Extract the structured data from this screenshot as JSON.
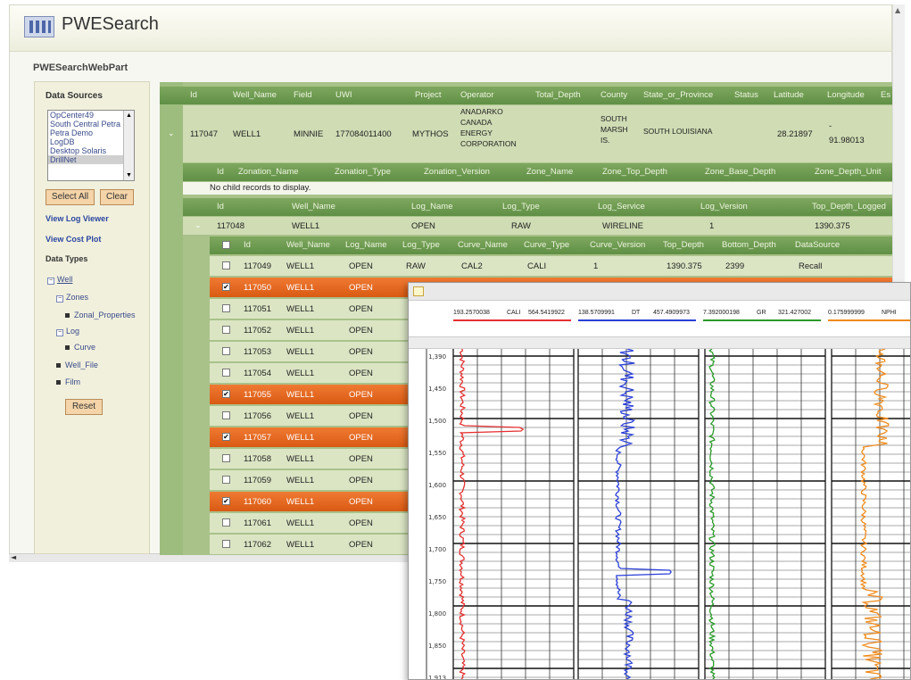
{
  "app": {
    "title": "PWESearch",
    "webpart_title": "PWESearchWebPart"
  },
  "left_panel": {
    "data_sources_title": "Data Sources",
    "data_sources": [
      "OpCenter49",
      "South Central Petra",
      "Petra Demo",
      "LogDB",
      "Desktop Solaris",
      "DrillNet"
    ],
    "select_all": "Select All",
    "clear": "Clear",
    "view_log_viewer": "View Log Viewer",
    "view_cost_plot": "View Cost Plot",
    "data_types_title": "Data Types",
    "tree": {
      "well": "Well",
      "zones": "Zones",
      "zonal_properties": "Zonal_Properties",
      "log": "Log",
      "curve": "Curve",
      "well_file": "Well_File",
      "film": "Film"
    },
    "reset": "Reset"
  },
  "well_grid": {
    "headers": [
      "Id",
      "Well_Name",
      "Field",
      "UWI",
      "Project",
      "Operator",
      "Total_Depth",
      "County",
      "State_or_Province",
      "Status",
      "Latitude",
      "Longitude",
      "Es"
    ],
    "row": {
      "id": "117047",
      "well_name": "WELL1",
      "field": "MINNIE",
      "uwi": "177084011400",
      "project": "MYTHOS",
      "operator": [
        "ANADARKO",
        "CANADA",
        "ENERGY",
        "CORPORATION"
      ],
      "county": [
        "SOUTH",
        "MARSH",
        "IS."
      ],
      "state": "SOUTH LOUISIANA",
      "latitude": "28.21897",
      "longitude_dash": "-",
      "longitude": "91.98013"
    }
  },
  "zonation_grid": {
    "headers": [
      "Id",
      "Zonation_Name",
      "Zonation_Type",
      "Zonation_Version",
      "Zone_Name",
      "Zone_Top_Depth",
      "Zone_Base_Depth",
      "Zone_Depth_Unit"
    ],
    "empty_text": "No child records to display."
  },
  "log_grid": {
    "headers": [
      "Id",
      "Well_Name",
      "Log_Name",
      "Log_Type",
      "Log_Service",
      "Log_Version",
      "Top_Depth_Logged"
    ],
    "row": {
      "id": "117048",
      "well_name": "WELL1",
      "log_name": "OPEN",
      "log_type": "RAW",
      "log_service": "WIRELINE",
      "log_version": "1",
      "top_depth": "1390.375"
    }
  },
  "curve_grid": {
    "headers": [
      "Id",
      "Well_Name",
      "Log_Name",
      "Log_Type",
      "Curve_Name",
      "Curve_Type",
      "Curve_Version",
      "Top_Depth",
      "Bottom_Depth",
      "DataSource"
    ],
    "first_row": {
      "id": "117049",
      "well_name": "WELL1",
      "log_name": "OPEN",
      "log_type": "RAW",
      "curve_name": "CAL2",
      "curve_type": "CALI",
      "curve_version": "1",
      "top_depth": "1390.375",
      "bottom_depth": "2399",
      "datasource": "Recall"
    },
    "rows": [
      {
        "id": "117050",
        "well_name": "WELL1",
        "log_name": "OPEN",
        "checked": true
      },
      {
        "id": "117051",
        "well_name": "WELL1",
        "log_name": "OPEN",
        "checked": false
      },
      {
        "id": "117052",
        "well_name": "WELL1",
        "log_name": "OPEN",
        "checked": false
      },
      {
        "id": "117053",
        "well_name": "WELL1",
        "log_name": "OPEN",
        "checked": false
      },
      {
        "id": "117054",
        "well_name": "WELL1",
        "log_name": "OPEN",
        "checked": false
      },
      {
        "id": "117055",
        "well_name": "WELL1",
        "log_name": "OPEN",
        "checked": true
      },
      {
        "id": "117056",
        "well_name": "WELL1",
        "log_name": "OPEN",
        "checked": false
      },
      {
        "id": "117057",
        "well_name": "WELL1",
        "log_name": "OPEN",
        "checked": true
      },
      {
        "id": "117058",
        "well_name": "WELL1",
        "log_name": "OPEN",
        "checked": false
      },
      {
        "id": "117059",
        "well_name": "WELL1",
        "log_name": "OPEN",
        "checked": false
      },
      {
        "id": "117060",
        "well_name": "WELL1",
        "log_name": "OPEN",
        "checked": true
      },
      {
        "id": "117061",
        "well_name": "WELL1",
        "log_name": "OPEN",
        "checked": false
      },
      {
        "id": "117062",
        "well_name": "WELL1",
        "log_name": "OPEN",
        "checked": false
      }
    ]
  },
  "log_viewer": {
    "legend": [
      {
        "min": "193.2570038",
        "name": "CALI",
        "max": "564.5419922",
        "color": "#e53030"
      },
      {
        "min": "138.5709991",
        "name": "DT",
        "max": "457.4909973",
        "color": "#2a3fd8"
      },
      {
        "min": "7.392000198",
        "name": "GR",
        "max": "321.427002",
        "color": "#2a9a2a"
      },
      {
        "min": "0.175999999",
        "name": "NPHI",
        "max": "",
        "color": "#f08a1a"
      }
    ],
    "depth_labels": [
      "1,390",
      "1,450",
      "1,500",
      "1,550",
      "1,600",
      "1,650",
      "1,700",
      "1,750",
      "1,800",
      "1,850",
      "1,913"
    ],
    "colors": {
      "CALI": "#e53030",
      "DT": "#2a3fd8",
      "GR": "#2a9a2a",
      "NPHI": "#f08a1a"
    }
  },
  "colors": {
    "grid_header": "#6a9a4e",
    "row": "#dbe5c4",
    "selected": "#e86a22"
  }
}
